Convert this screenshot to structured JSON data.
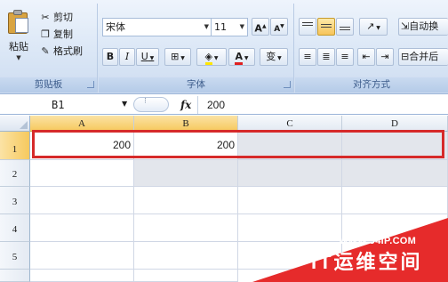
{
  "ribbon": {
    "clipboard": {
      "paste_label": "粘贴",
      "cut_label": "剪切",
      "copy_label": "复制",
      "format_painter_label": "格式刷",
      "group_label": "剪贴板"
    },
    "font": {
      "font_name": "宋体",
      "font_size": "11",
      "grow_label": "A",
      "shrink_label": "A",
      "bold": "B",
      "italic": "I",
      "underline": "U",
      "font_color_label": "A",
      "phonetic_label": "变",
      "group_label": "字体"
    },
    "alignment": {
      "wrap_label": "自动换",
      "merge_label": "合并后",
      "group_label": "对齐方式"
    }
  },
  "formula_bar": {
    "name_box": "B1",
    "fx": "fx",
    "value": "200"
  },
  "sheet": {
    "columns": [
      "A",
      "B",
      "C",
      "D"
    ],
    "rows": [
      "1",
      "2",
      "3",
      "4",
      "5"
    ],
    "cells": {
      "A1": "200",
      "B1": "200"
    }
  },
  "watermark": {
    "url": "WWW.94IP.COM",
    "brand": "IT运维空间"
  },
  "colors": {
    "highlight": "#d62a2a",
    "selection_header": "#f6c95e",
    "watermark": "#e62b2b"
  }
}
